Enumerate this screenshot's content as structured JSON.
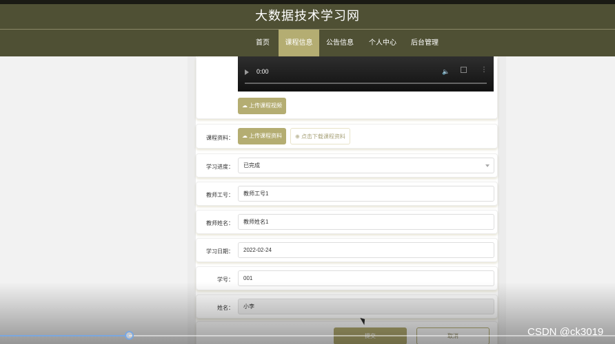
{
  "header": {
    "site_title": "大数据技术学习网",
    "nav": [
      {
        "label": "首页",
        "active": false
      },
      {
        "label": "课程信息",
        "active": true
      },
      {
        "label": "公告信息",
        "active": false
      },
      {
        "label": "个人中心",
        "active": false
      },
      {
        "label": "后台管理",
        "active": false
      }
    ]
  },
  "video_player": {
    "time": "0:00"
  },
  "form": {
    "upload_video_button": "上传课程视频",
    "course_material": {
      "label": "课程资料：",
      "upload_button": "上传课程资料",
      "download_button": "点击下载课程资料"
    },
    "progress": {
      "label": "学习进度：",
      "value": "已完成"
    },
    "teacher_id": {
      "label": "教师工号：",
      "value": "教师工号1"
    },
    "teacher_name": {
      "label": "教师姓名：",
      "value": "教师姓名1"
    },
    "study_date": {
      "label": "学习日期：",
      "value": "2022-02-24"
    },
    "student_id": {
      "label": "学号：",
      "value": "001"
    },
    "name": {
      "label": "姓名：",
      "value": "小李"
    },
    "submit_button": "提交",
    "cancel_button": "取消"
  },
  "watermark": "CSDN @ck3019",
  "colors": {
    "header_bg": "#4f5034",
    "accent": "#b4ad72",
    "progress_bar": "#7aa7e0"
  },
  "playback_progress": 0.21
}
